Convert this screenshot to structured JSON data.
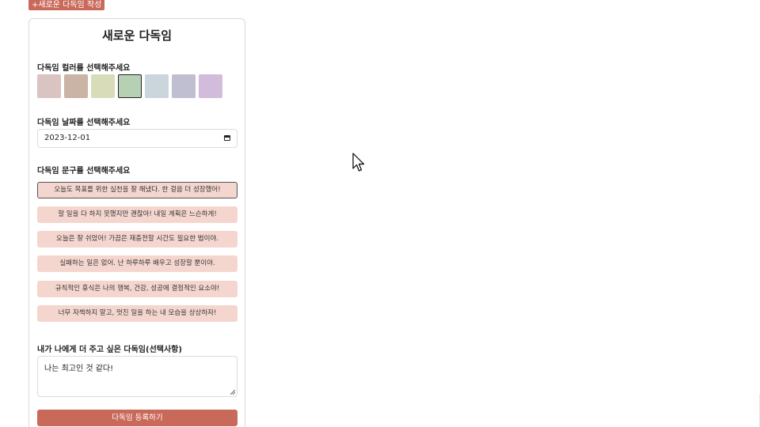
{
  "header": {
    "new_button_label": "+새로운 다독임 작성"
  },
  "form": {
    "title": "새로운 다독임",
    "color_label": "다독임 컬러를 선택해주세요",
    "colors": [
      "#d9c4c1",
      "#c9b4a5",
      "#d9dcb9",
      "#b5d0b2",
      "#cbd5dc",
      "#c0bfd1",
      "#d1bcdc"
    ],
    "selected_color_index": 3,
    "date_label": "다독임 날짜를 선택해주세요",
    "date_value": "2023-12-01",
    "phrase_label": "다독임 문구를 선택해주세요",
    "phrases": [
      "오늘도 목표를 위한 실천을 잘 해냈다. 한 걸음 더 성장했어!",
      "할 일을 다 하지 못했지만 괜찮아! 내일 계획은 느슨하게!",
      "오늘은 잘 쉬었어! 가끔은 재충전할 시간도 필요한 법이야.",
      "실패하는 일은 없어. 난 하루하루 배우고 성장할 뿐이야.",
      "규칙적인 휴식은 나의 행복, 건강, 성공에 결정적인 요소야!",
      "너무 자책하지 말고, 멋진 일을 하는 내 모습을 상상하자!"
    ],
    "selected_phrase_index": 0,
    "message_label": "내가 나에게 더 주고 싶은 다독임(선택사항)",
    "message_value": "나는 최고인 것 같다!",
    "submit_label": "다독임 등록하기"
  }
}
